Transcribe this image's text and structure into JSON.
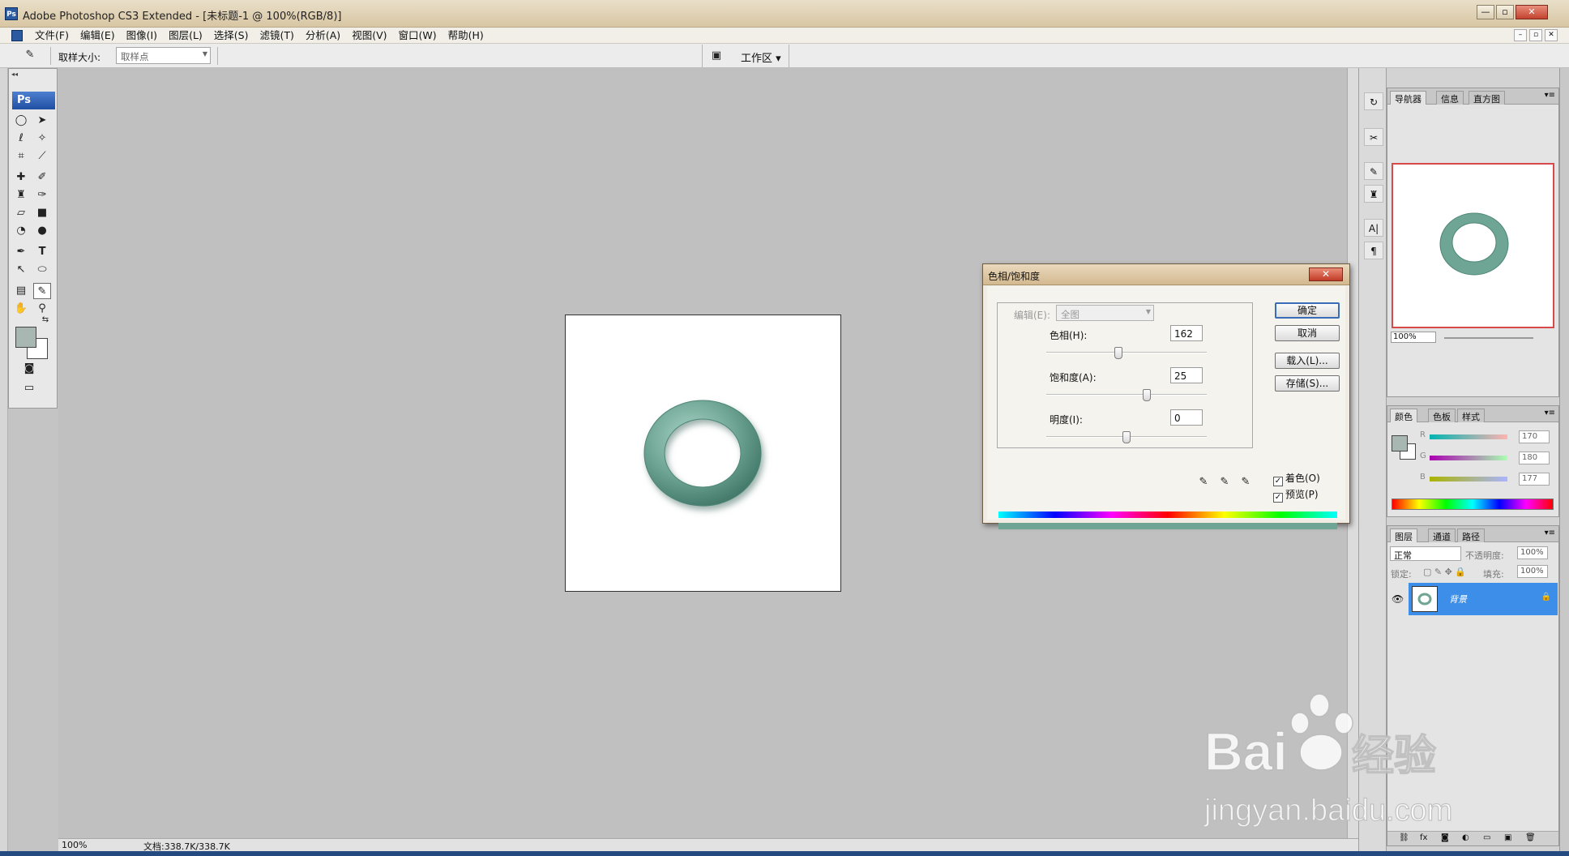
{
  "window": {
    "title": "Adobe Photoshop CS3 Extended - [未标题-1 @ 100%(RGB/8)]",
    "buttons": [
      "—",
      "▫",
      "✕"
    ]
  },
  "menu": [
    "文件(F)",
    "编辑(E)",
    "图像(I)",
    "图层(L)",
    "选择(S)",
    "滤镜(T)",
    "分析(A)",
    "视图(V)",
    "窗口(W)",
    "帮助(H)"
  ],
  "options": {
    "sample_size_label": "取样大小:",
    "sample_size_value": "取样点",
    "workspace_label": "工作区"
  },
  "toolbox": {
    "logo": "Ps",
    "type_tool_glyph": "T"
  },
  "dialog": {
    "title": "色相/饱和度",
    "close": "✕",
    "edit_label": "编辑(E):",
    "edit_value": "全图",
    "hue_label": "色相(H):",
    "hue_value": "162",
    "saturation_label": "饱和度(A):",
    "saturation_value": "25",
    "lightness_label": "明度(I):",
    "lightness_value": "0",
    "slider_fraction": {
      "hue": 0.45,
      "saturation": 0.625,
      "lightness": 0.5
    },
    "buttons": {
      "ok": "确定",
      "cancel": "取消",
      "load": "载入(L)...",
      "save": "存储(S)..."
    },
    "colorize_label": "着色(O)",
    "colorize_checked": true,
    "preview_label": "预览(P)",
    "preview_checked": true,
    "colorized_bar_color": "#6fa594"
  },
  "status": {
    "zoom": "100%",
    "doc_info": "文档:338.7K/338.7K"
  },
  "navigator": {
    "tabs": [
      "导航器",
      "信息",
      "直方图"
    ],
    "zoom": "100%"
  },
  "color_panel": {
    "tabs": [
      "颜色",
      "色板",
      "样式"
    ],
    "channels": [
      {
        "label": "R",
        "value": "170"
      },
      {
        "label": "G",
        "value": "180"
      },
      {
        "label": "B",
        "value": "177"
      }
    ],
    "foreground": "#a9b7b2"
  },
  "layers_panel": {
    "tabs": [
      "图层",
      "通道",
      "路径"
    ],
    "blend_mode": "正常",
    "opacity_label": "不透明度:",
    "opacity_value": "100%",
    "lock_label": "锁定:",
    "fill_label": "填充:",
    "fill_value": "100%",
    "layer_name": "背景"
  },
  "ring": {
    "color": "#6fa594"
  },
  "watermark": {
    "brand": "Bai",
    "brand_suffix": "经验",
    "url": "jingyan.baidu.com"
  }
}
